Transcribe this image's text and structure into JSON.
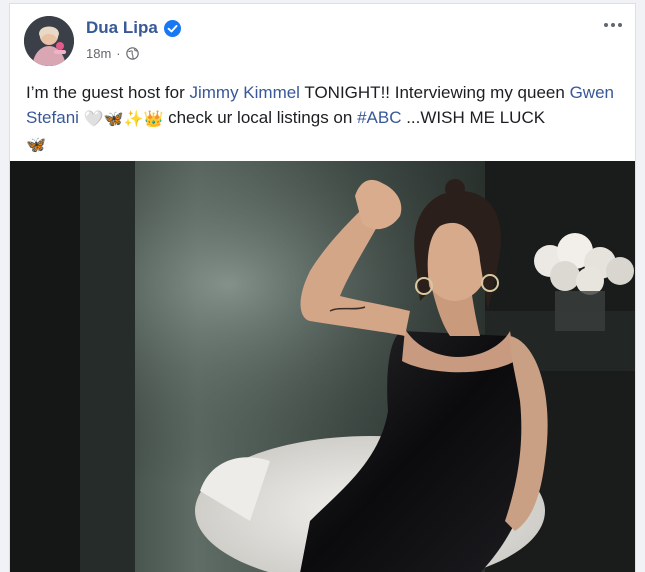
{
  "post": {
    "author": "Dua Lipa",
    "timestamp": "18m",
    "separator": "·",
    "privacy_icon": "globe-icon",
    "verified_icon": "verified-badge-icon",
    "text": {
      "t1": "I’m the guest host for ",
      "link_jimmy": "Jimmy Kimmel",
      "t2": " TONIGHT!! Interviewing my queen ",
      "link_gwen": "Gwen Stefani",
      "emojis1": "🤍🦋✨👑",
      "t3": " check ur local listings on ",
      "hashtag": "#ABC",
      "t4": " ...WISH ME LUCK ",
      "emojis2": "🦋"
    }
  },
  "colors": {
    "link": "#385898",
    "verified": "#1877f2",
    "text": "#1c1e21",
    "meta": "#65676b"
  }
}
